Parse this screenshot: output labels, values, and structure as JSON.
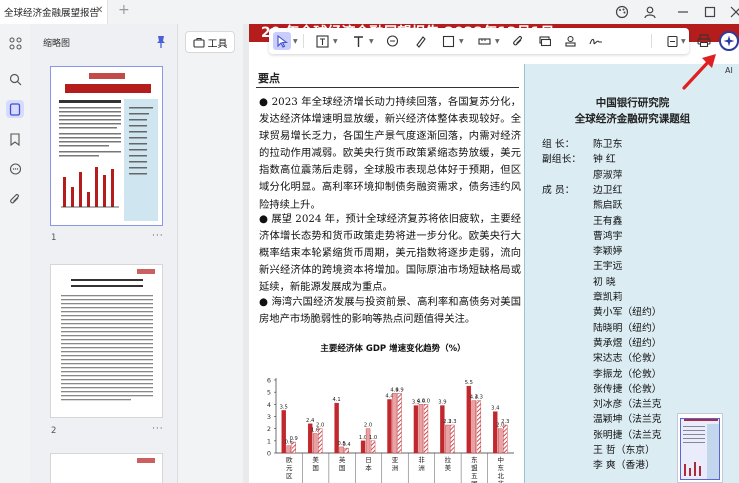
{
  "window": {
    "tab_title": "全球经济金融展望报告",
    "tab_close": "✕",
    "new_tab": "+"
  },
  "sidebar": {
    "title": "缩略图",
    "pages": [
      {
        "number": "1",
        "more": "···"
      },
      {
        "number": "2",
        "more": "···"
      }
    ]
  },
  "toolbar": {
    "tools_label": "工具",
    "ai_label": "AI"
  },
  "document": {
    "header_band_text": "20  年全球经济金融展望报告  2022年12月1日",
    "key_points_heading": "要点",
    "paragraphs": [
      "● 2023 年全球经济增长动力持续回落，各国复苏分化，发达经济体增速明显放缓，新兴经济体整体表现较好。全球贸易增长乏力，各国生产景气度逐渐回落，内需对经济的拉动作用减弱。欧美央行货币政策紧缩态势放缓，美元指数高位震荡后走弱，全球股市表现总体好于预期，但区域分化明显。高利率环境抑制债务融资需求，债务违约风险持续上升。",
      "● 展望 2024 年，预计全球经济复苏将依旧疲软，主要经济体增长态势和货币政策走势将进一步分化。欧美央行大概率结束本轮紧缩货币周期，美元指数将逐步走弱，流向新兴经济体的跨境资本将增加。国际原油市场短缺格局或延续，新能源发展成为重点。",
      "● 海湾六国经济发展与投资前景、高利率和高债务对美国房地产市场脆弱性的影响等热点问题值得关注。"
    ],
    "side_org_line1": "中国银行研究院",
    "side_org_line2": "全球经济金融研究课题组",
    "team": [
      {
        "role": "组    长：",
        "name": "陈卫东"
      },
      {
        "role": "副组长：",
        "name": "钟    红"
      },
      {
        "role": "",
        "name": "廖淑萍"
      },
      {
        "role": "成    员：",
        "name": "边卫红"
      },
      {
        "role": "",
        "name": "熊启跃"
      },
      {
        "role": "",
        "name": "王有鑫"
      },
      {
        "role": "",
        "name": "曹鸿宇"
      },
      {
        "role": "",
        "name": "李颖婷"
      },
      {
        "role": "",
        "name": "王宇远"
      },
      {
        "role": "",
        "name": "初    晓"
      },
      {
        "role": "",
        "name": "章凯莉"
      },
      {
        "role": "",
        "name": "黄小军（纽约）"
      },
      {
        "role": "",
        "name": "陆晓明（纽约）"
      },
      {
        "role": "",
        "name": "黄承煜（纽约）"
      },
      {
        "role": "",
        "name": "宋达志（伦敦）"
      },
      {
        "role": "",
        "name": "李振龙（伦敦）"
      },
      {
        "role": "",
        "name": "张传捷（伦敦）"
      },
      {
        "role": "",
        "name": "刘冰彦（法兰克"
      },
      {
        "role": "",
        "name": "温颖坤（法兰克"
      },
      {
        "role": "",
        "name": "张明捷（法兰克"
      },
      {
        "role": "",
        "name": "王    哲（东京）"
      },
      {
        "role": "",
        "name": "李    爽（香港）"
      }
    ]
  },
  "chart_data": {
    "type": "bar",
    "title": "主要经济体 GDP 增速变化趋势（%）",
    "ylim": [
      0,
      6
    ],
    "yticks": [
      0,
      1,
      2,
      3,
      4,
      5,
      6
    ],
    "categories": [
      "欧元区",
      "美国",
      "英国",
      "日本",
      "亚洲",
      "非洲",
      "拉美",
      "东盟五国",
      "中东北非"
    ],
    "series": [
      {
        "values": [
          3.5,
          2.4,
          4.1,
          1.0,
          4.4,
          3.9,
          3.9,
          5.5,
          3.4
        ]
      },
      {
        "values": [
          0.6,
          1.6,
          0.5,
          2.0,
          4.9,
          4.0,
          2.3,
          4.3,
          2.0
        ]
      },
      {
        "values": [
          0.9,
          2.0,
          0.4,
          1.0,
          4.9,
          4.0,
          2.3,
          4.3,
          2.3
        ]
      }
    ],
    "labels": [
      [
        "3.5",
        "0.6",
        "0.9"
      ],
      [
        "2.4",
        "1.6",
        "2.0"
      ],
      [
        "4.1",
        "0.5",
        "0.4"
      ],
      [
        "1.0",
        "2.0",
        "1.0"
      ],
      [
        "4.4",
        "4.9",
        "4.9"
      ],
      [
        "3.9",
        "4.0",
        "4.0"
      ],
      [
        "3.9",
        "2.3",
        "2.3"
      ],
      [
        "5.5",
        "4.3",
        "4.3"
      ],
      [
        "3.4",
        "2.0",
        "2.3"
      ]
    ],
    "colors": [
      "#c0282d",
      "#e8a3a5",
      "#c0282d"
    ]
  },
  "colors": {
    "accent": "#4c5fd5",
    "brand_red": "#b51d1d",
    "side_panel": "#dbecf3",
    "arrow_red": "#e02020"
  }
}
